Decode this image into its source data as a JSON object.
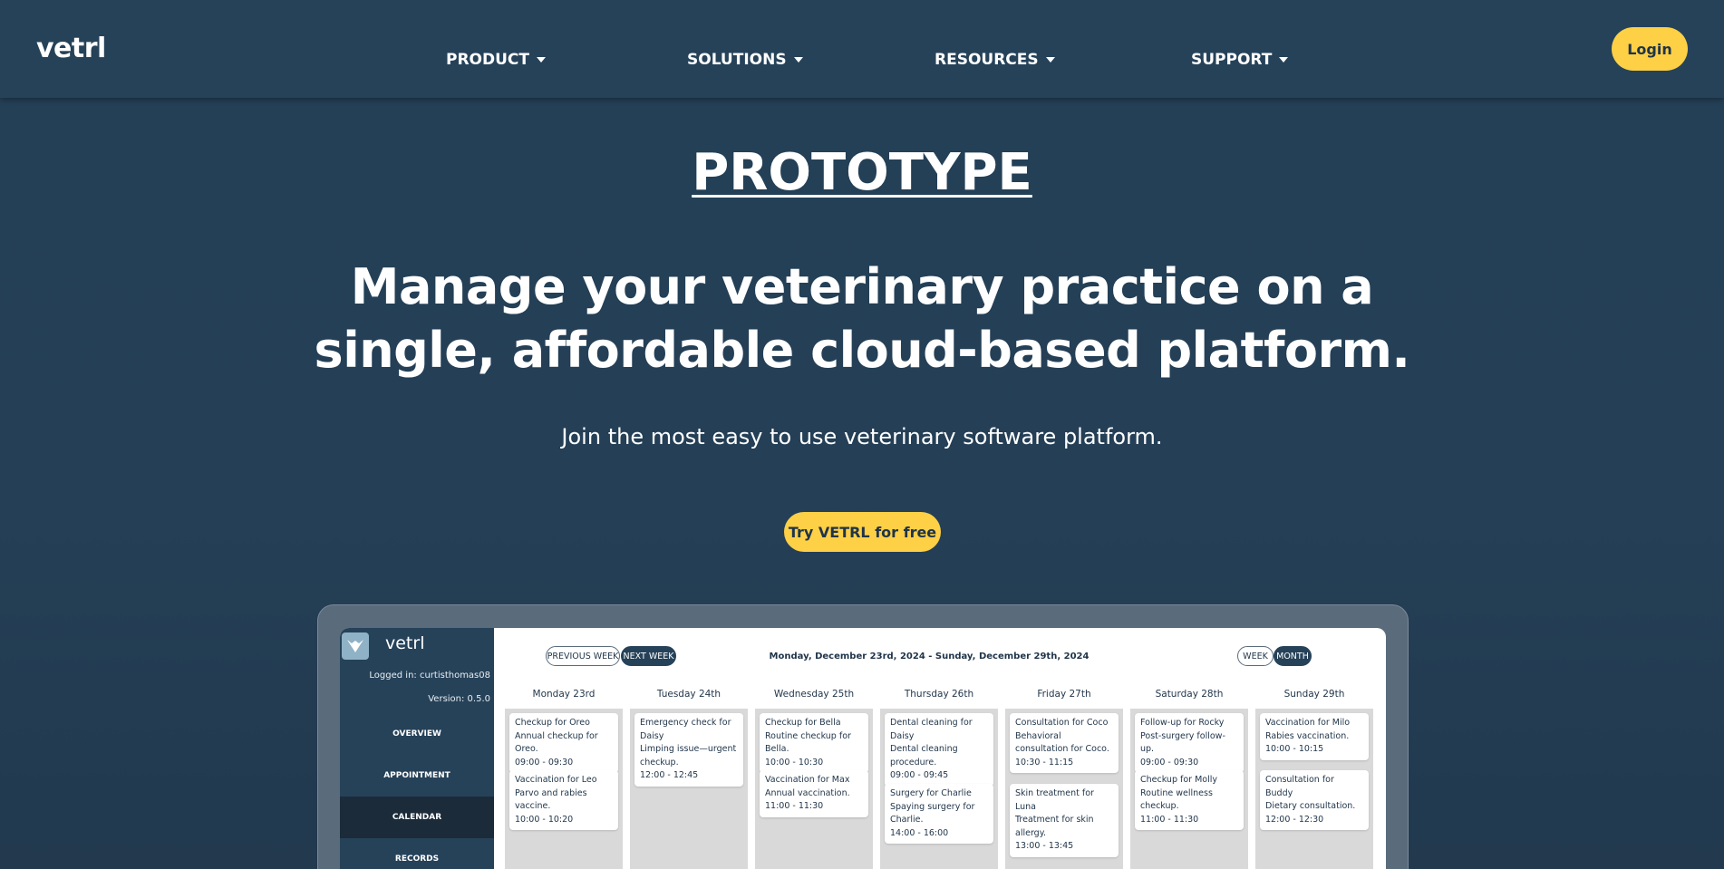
{
  "nav": {
    "brand": "vetrl",
    "items": [
      {
        "label": "PRODUCT"
      },
      {
        "label": "SOLUTIONS"
      },
      {
        "label": "RESOURCES"
      },
      {
        "label": "SUPPORT"
      }
    ],
    "login_label": "Login"
  },
  "hero": {
    "prototype": "PROTOTYPE",
    "headline_line1": "Manage your veterinary practice on a",
    "headline_line2": "single, affordable cloud-based platform.",
    "subtitle": "Join the most easy to use veterinary software platform.",
    "cta_label": "Try VETRL for free"
  },
  "colors": {
    "background": "#244057",
    "accent": "#fdd046",
    "sidebar": "#264259"
  },
  "app_preview": {
    "brand": "vetrl",
    "logged_in": "Logged in: curtisthomas08",
    "version": "Version: 0.5.0",
    "sidebar": [
      "OVERVIEW",
      "APPOINTMENT",
      "CALENDAR",
      "RECORDS"
    ],
    "active_item": "CALENDAR",
    "prev_week": "PREVIOUS WEEK",
    "next_week": "NEXT WEEK",
    "date_range": "Monday, December 23rd, 2024 - Sunday, December 29th, 2024",
    "view_week": "WEEK",
    "view_month": "MONTH",
    "days": [
      {
        "name": "Monday 23rd",
        "appointments": [
          {
            "title": "Checkup for Oreo",
            "desc": "Annual checkup for Oreo.",
            "time": "09:00 - 09:30"
          },
          {
            "title": "Vaccination for Leo",
            "desc": "Parvo and rabies vaccine.",
            "time": "10:00 - 10:20"
          }
        ]
      },
      {
        "name": "Tuesday 24th",
        "appointments": [
          {
            "title": "Emergency check for Daisy",
            "desc": "Limping issue—urgent checkup.",
            "time": "12:00 - 12:45"
          }
        ]
      },
      {
        "name": "Wednesday 25th",
        "appointments": [
          {
            "title": "Checkup for Bella",
            "desc": "Routine checkup for Bella.",
            "time": "10:00 - 10:30"
          },
          {
            "title": "Vaccination for Max",
            "desc": "Annual vaccination.",
            "time": "11:00 - 11:30"
          }
        ]
      },
      {
        "name": "Thursday 26th",
        "appointments": [
          {
            "title": "Dental cleaning for Daisy",
            "desc": "Dental cleaning procedure.",
            "time": "09:00 - 09:45"
          },
          {
            "title": "Surgery for Charlie",
            "desc": "Spaying surgery for Charlie.",
            "time": "14:00 - 16:00"
          }
        ]
      },
      {
        "name": "Friday 27th",
        "appointments": [
          {
            "title": "Consultation for Coco",
            "desc": "Behavioral consultation for Coco.",
            "time": "10:30 - 11:15"
          },
          {
            "title": "Skin treatment for Luna",
            "desc": "Treatment for skin allergy.",
            "time": "13:00 - 13:45"
          }
        ]
      },
      {
        "name": "Saturday 28th",
        "appointments": [
          {
            "title": "Follow-up for Rocky",
            "desc": "Post-surgery follow-up.",
            "time": "09:00 - 09:30"
          },
          {
            "title": "Checkup for Molly",
            "desc": "Routine wellness checkup.",
            "time": "11:00 - 11:30"
          }
        ]
      },
      {
        "name": "Sunday 29th",
        "appointments": [
          {
            "title": "Vaccination for Milo",
            "desc": "Rabies vaccination.",
            "time": "10:00 - 10:15"
          },
          {
            "title": "Consultation for Buddy",
            "desc": "Dietary consultation.",
            "time": "12:00 - 12:30"
          }
        ]
      }
    ]
  }
}
